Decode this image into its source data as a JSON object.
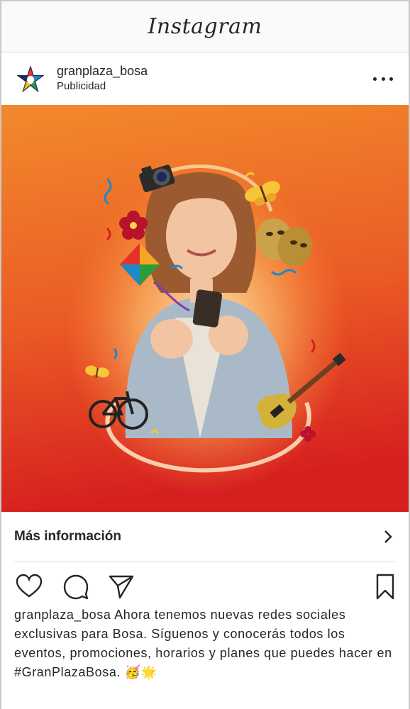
{
  "app": {
    "logo_text": "Instagram"
  },
  "post": {
    "username": "granplaza_bosa",
    "sponsored_label": "Publicidad",
    "image_alt_icons": [
      "camera-icon",
      "kite-icon",
      "flower-icon",
      "butterfly-icon",
      "theatre-masks-icon",
      "bicycle-icon",
      "electric-guitar-icon",
      "confetti-icon"
    ]
  },
  "cta": {
    "label": "Más información"
  },
  "caption": {
    "username": "granplaza_bosa",
    "text": "Ahora tenemos nuevas redes sociales exclusivas para Bosa. Síguenos y conocerás todos los eventos, promociones, horarios y planes que puedes hacer en #GranPlazaBosa. 🥳🌟"
  },
  "colors": {
    "bg_orange": "#f0822a",
    "bg_red": "#d8201e",
    "text": "#262626",
    "divider": "#dbdbdb"
  }
}
